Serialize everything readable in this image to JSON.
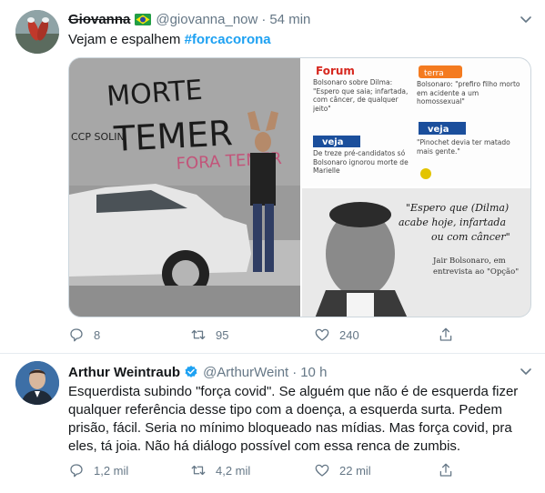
{
  "tweets": [
    {
      "author_name": "Giovanna",
      "flag_icon": "brazil-flag-icon",
      "handle": "@giovanna_now",
      "separator": "·",
      "time": "54 min",
      "text": "Vejam e espalhem",
      "hashtag": "#forcacorona",
      "media": {
        "graffiti_line1": "MORTE",
        "graffiti_line2": "TEMER",
        "graffiti_side": "CCP SOLIN",
        "graffiti_red": "FORA TEMER",
        "forum_logo": "Forum",
        "forum_text": "Bolsonaro sobre Dilma: \"Espero que saia; infartada, com câncer, de qualquer jeito\"",
        "terra_logo": "terra",
        "terra_text": "Bolsonaro: \"prefiro filho morto em acidente a um homossexual\"",
        "veja_logo_1": "veja",
        "veja_text_1": "De treze pré-candidatos só Bolsonaro ignorou morte de Marielle",
        "veja_logo_2": "veja",
        "veja_text_2": "\"Pinochet devia ter matado mais gente.\"",
        "quote_line1": "\"Espero que (Dilma)",
        "quote_line2": "acabe hoje, infartada",
        "quote_line3": "ou com câncer\"",
        "attribution_line1": "Jair Bolsonaro, em",
        "attribution_line2": "entrevista ao \"Opção\""
      },
      "actions": {
        "replies": "8",
        "retweets": "95",
        "likes": "240"
      }
    },
    {
      "author_name": "Arthur Weintraub",
      "handle": "@ArthurWeint",
      "separator": "·",
      "time": "10 h",
      "verified_icon": "verified-badge-icon",
      "text_lines": [
        "Esquerdista subindo \"força covid\". Se alguém que não é de esquerda fizer",
        "qualquer referência desse tipo com a doença, a esquerda surta. Pedem",
        "prisão, fácil. Seria no mínimo bloqueado nas mídias. Mas força covid, pra",
        "eles, tá joia. Não há diálogo possível com essa renca de zumbis."
      ],
      "actions": {
        "replies": "1,2 mil",
        "retweets": "4,2 mil",
        "likes": "22 mil"
      }
    }
  ],
  "colors": {
    "accent": "#1da1f2",
    "text_primary": "#14171a",
    "text_secondary": "#657786",
    "divider": "#e6ecf0",
    "verified": "#1da1f2"
  }
}
